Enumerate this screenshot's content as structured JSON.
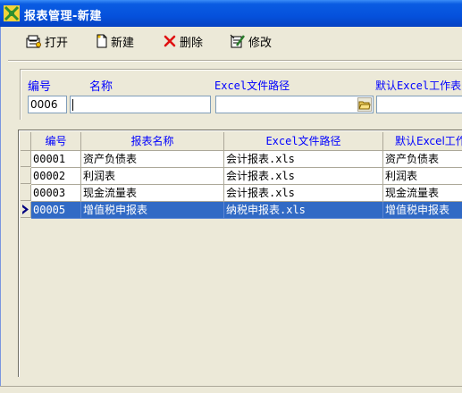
{
  "window": {
    "title": "报表管理-新建"
  },
  "toolbar": {
    "open_label": "打开",
    "new_label": "新建",
    "delete_label": "删除",
    "edit_label": "修改"
  },
  "form": {
    "id_label": "编号",
    "name_label": "名称",
    "path_label": "Excel文件路径",
    "sheet_label": "默认Excel工作表",
    "id_value": "0006",
    "name_value": "",
    "path_value": "",
    "sheet_value": ""
  },
  "table": {
    "columns": [
      "编号",
      "报表名称",
      "Excel文件路径",
      "默认Excel工作表"
    ],
    "rows": [
      {
        "id": "00001",
        "name": "资产负债表",
        "path": "会计报表.xls",
        "sheet": "资产负债表"
      },
      {
        "id": "00002",
        "name": "利润表",
        "path": "会计报表.xls",
        "sheet": "利润表"
      },
      {
        "id": "00003",
        "name": "现金流量表",
        "path": "会计报表.xls",
        "sheet": "现金流量表"
      },
      {
        "id": "00005",
        "name": "增值税申报表",
        "path": "纳税申报表.xls",
        "sheet": "增值税申报表"
      }
    ],
    "selected_row": 3
  },
  "colors": {
    "label_blue": "#0000ff",
    "selection": "#316ac5",
    "titlebar": "#0551dc"
  },
  "icons": [
    "app-icon",
    "open-icon",
    "new-icon",
    "delete-icon",
    "edit-icon",
    "browse-folder-icon",
    "row-pointer-icon"
  ]
}
